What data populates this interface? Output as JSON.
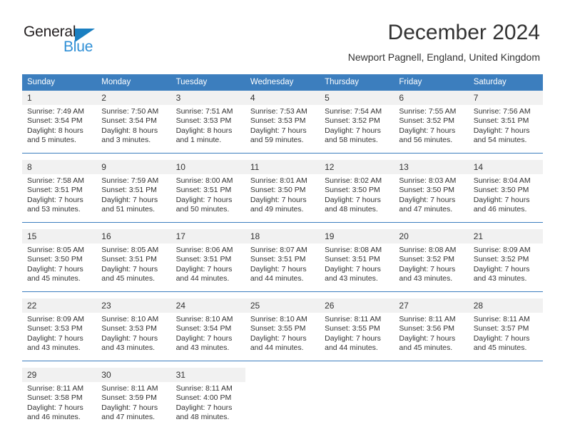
{
  "logo": {
    "word_top": "General",
    "word_bottom": "Blue",
    "triangle_color": "#1a7fc1",
    "blue_color": "#2f8fd6"
  },
  "header": {
    "title": "December 2024",
    "subtitle": "Newport Pagnell, England, United Kingdom"
  },
  "theme": {
    "header_bg": "#3c7ebe",
    "header_text": "#ffffff",
    "daynum_bg": "#f1f1f1",
    "body_text": "#333333",
    "rule_color": "#3c7ebe"
  },
  "calendar": {
    "weekday_headers": [
      "Sunday",
      "Monday",
      "Tuesday",
      "Wednesday",
      "Thursday",
      "Friday",
      "Saturday"
    ],
    "weeks": [
      [
        {
          "day": "1",
          "sunrise": "Sunrise: 7:49 AM",
          "sunset": "Sunset: 3:54 PM",
          "daylight1": "Daylight: 8 hours",
          "daylight2": "and 5 minutes."
        },
        {
          "day": "2",
          "sunrise": "Sunrise: 7:50 AM",
          "sunset": "Sunset: 3:54 PM",
          "daylight1": "Daylight: 8 hours",
          "daylight2": "and 3 minutes."
        },
        {
          "day": "3",
          "sunrise": "Sunrise: 7:51 AM",
          "sunset": "Sunset: 3:53 PM",
          "daylight1": "Daylight: 8 hours",
          "daylight2": "and 1 minute."
        },
        {
          "day": "4",
          "sunrise": "Sunrise: 7:53 AM",
          "sunset": "Sunset: 3:53 PM",
          "daylight1": "Daylight: 7 hours",
          "daylight2": "and 59 minutes."
        },
        {
          "day": "5",
          "sunrise": "Sunrise: 7:54 AM",
          "sunset": "Sunset: 3:52 PM",
          "daylight1": "Daylight: 7 hours",
          "daylight2": "and 58 minutes."
        },
        {
          "day": "6",
          "sunrise": "Sunrise: 7:55 AM",
          "sunset": "Sunset: 3:52 PM",
          "daylight1": "Daylight: 7 hours",
          "daylight2": "and 56 minutes."
        },
        {
          "day": "7",
          "sunrise": "Sunrise: 7:56 AM",
          "sunset": "Sunset: 3:51 PM",
          "daylight1": "Daylight: 7 hours",
          "daylight2": "and 54 minutes."
        }
      ],
      [
        {
          "day": "8",
          "sunrise": "Sunrise: 7:58 AM",
          "sunset": "Sunset: 3:51 PM",
          "daylight1": "Daylight: 7 hours",
          "daylight2": "and 53 minutes."
        },
        {
          "day": "9",
          "sunrise": "Sunrise: 7:59 AM",
          "sunset": "Sunset: 3:51 PM",
          "daylight1": "Daylight: 7 hours",
          "daylight2": "and 51 minutes."
        },
        {
          "day": "10",
          "sunrise": "Sunrise: 8:00 AM",
          "sunset": "Sunset: 3:51 PM",
          "daylight1": "Daylight: 7 hours",
          "daylight2": "and 50 minutes."
        },
        {
          "day": "11",
          "sunrise": "Sunrise: 8:01 AM",
          "sunset": "Sunset: 3:50 PM",
          "daylight1": "Daylight: 7 hours",
          "daylight2": "and 49 minutes."
        },
        {
          "day": "12",
          "sunrise": "Sunrise: 8:02 AM",
          "sunset": "Sunset: 3:50 PM",
          "daylight1": "Daylight: 7 hours",
          "daylight2": "and 48 minutes."
        },
        {
          "day": "13",
          "sunrise": "Sunrise: 8:03 AM",
          "sunset": "Sunset: 3:50 PM",
          "daylight1": "Daylight: 7 hours",
          "daylight2": "and 47 minutes."
        },
        {
          "day": "14",
          "sunrise": "Sunrise: 8:04 AM",
          "sunset": "Sunset: 3:50 PM",
          "daylight1": "Daylight: 7 hours",
          "daylight2": "and 46 minutes."
        }
      ],
      [
        {
          "day": "15",
          "sunrise": "Sunrise: 8:05 AM",
          "sunset": "Sunset: 3:50 PM",
          "daylight1": "Daylight: 7 hours",
          "daylight2": "and 45 minutes."
        },
        {
          "day": "16",
          "sunrise": "Sunrise: 8:05 AM",
          "sunset": "Sunset: 3:51 PM",
          "daylight1": "Daylight: 7 hours",
          "daylight2": "and 45 minutes."
        },
        {
          "day": "17",
          "sunrise": "Sunrise: 8:06 AM",
          "sunset": "Sunset: 3:51 PM",
          "daylight1": "Daylight: 7 hours",
          "daylight2": "and 44 minutes."
        },
        {
          "day": "18",
          "sunrise": "Sunrise: 8:07 AM",
          "sunset": "Sunset: 3:51 PM",
          "daylight1": "Daylight: 7 hours",
          "daylight2": "and 44 minutes."
        },
        {
          "day": "19",
          "sunrise": "Sunrise: 8:08 AM",
          "sunset": "Sunset: 3:51 PM",
          "daylight1": "Daylight: 7 hours",
          "daylight2": "and 43 minutes."
        },
        {
          "day": "20",
          "sunrise": "Sunrise: 8:08 AM",
          "sunset": "Sunset: 3:52 PM",
          "daylight1": "Daylight: 7 hours",
          "daylight2": "and 43 minutes."
        },
        {
          "day": "21",
          "sunrise": "Sunrise: 8:09 AM",
          "sunset": "Sunset: 3:52 PM",
          "daylight1": "Daylight: 7 hours",
          "daylight2": "and 43 minutes."
        }
      ],
      [
        {
          "day": "22",
          "sunrise": "Sunrise: 8:09 AM",
          "sunset": "Sunset: 3:53 PM",
          "daylight1": "Daylight: 7 hours",
          "daylight2": "and 43 minutes."
        },
        {
          "day": "23",
          "sunrise": "Sunrise: 8:10 AM",
          "sunset": "Sunset: 3:53 PM",
          "daylight1": "Daylight: 7 hours",
          "daylight2": "and 43 minutes."
        },
        {
          "day": "24",
          "sunrise": "Sunrise: 8:10 AM",
          "sunset": "Sunset: 3:54 PM",
          "daylight1": "Daylight: 7 hours",
          "daylight2": "and 43 minutes."
        },
        {
          "day": "25",
          "sunrise": "Sunrise: 8:10 AM",
          "sunset": "Sunset: 3:55 PM",
          "daylight1": "Daylight: 7 hours",
          "daylight2": "and 44 minutes."
        },
        {
          "day": "26",
          "sunrise": "Sunrise: 8:11 AM",
          "sunset": "Sunset: 3:55 PM",
          "daylight1": "Daylight: 7 hours",
          "daylight2": "and 44 minutes."
        },
        {
          "day": "27",
          "sunrise": "Sunrise: 8:11 AM",
          "sunset": "Sunset: 3:56 PM",
          "daylight1": "Daylight: 7 hours",
          "daylight2": "and 45 minutes."
        },
        {
          "day": "28",
          "sunrise": "Sunrise: 8:11 AM",
          "sunset": "Sunset: 3:57 PM",
          "daylight1": "Daylight: 7 hours",
          "daylight2": "and 45 minutes."
        }
      ],
      [
        {
          "day": "29",
          "sunrise": "Sunrise: 8:11 AM",
          "sunset": "Sunset: 3:58 PM",
          "daylight1": "Daylight: 7 hours",
          "daylight2": "and 46 minutes."
        },
        {
          "day": "30",
          "sunrise": "Sunrise: 8:11 AM",
          "sunset": "Sunset: 3:59 PM",
          "daylight1": "Daylight: 7 hours",
          "daylight2": "and 47 minutes."
        },
        {
          "day": "31",
          "sunrise": "Sunrise: 8:11 AM",
          "sunset": "Sunset: 4:00 PM",
          "daylight1": "Daylight: 7 hours",
          "daylight2": "and 48 minutes."
        },
        {
          "day": "",
          "sunrise": "",
          "sunset": "",
          "daylight1": "",
          "daylight2": ""
        },
        {
          "day": "",
          "sunrise": "",
          "sunset": "",
          "daylight1": "",
          "daylight2": ""
        },
        {
          "day": "",
          "sunrise": "",
          "sunset": "",
          "daylight1": "",
          "daylight2": ""
        },
        {
          "day": "",
          "sunrise": "",
          "sunset": "",
          "daylight1": "",
          "daylight2": ""
        }
      ]
    ]
  }
}
